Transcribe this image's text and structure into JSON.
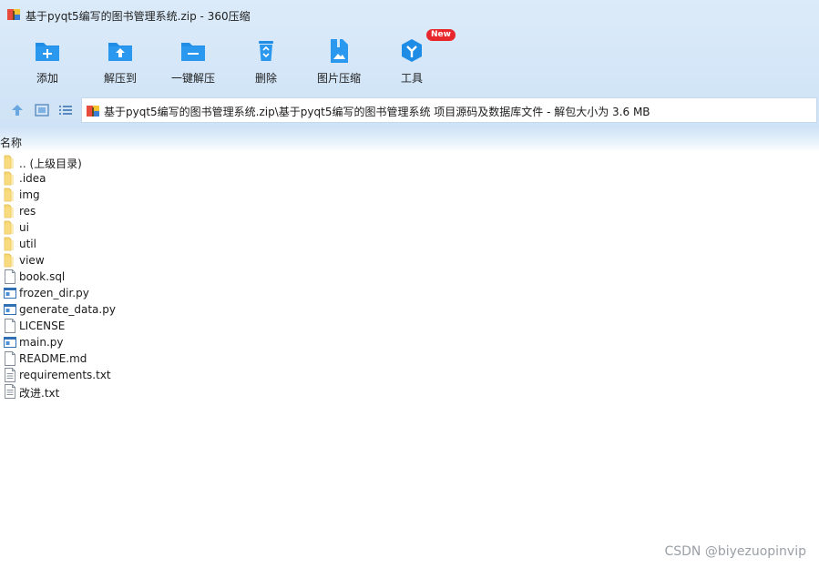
{
  "window": {
    "title": "基于pyqt5编写的图书管理系统.zip - 360压缩"
  },
  "toolbar": [
    {
      "label": "添加",
      "icon": "add-folder-icon"
    },
    {
      "label": "解压到",
      "icon": "extract-to-icon"
    },
    {
      "label": "一键解压",
      "icon": "one-click-extract-icon"
    },
    {
      "label": "删除",
      "icon": "recycle-delete-icon"
    },
    {
      "label": "图片压缩",
      "icon": "image-compress-icon"
    },
    {
      "label": "工具",
      "icon": "tools-icon",
      "badge": "New"
    }
  ],
  "address": {
    "path": "基于pyqt5编写的图书管理系统.zip\\基于pyqt5编写的图书管理系统 项目源码及数据库文件 - 解包大小为 3.6 MB"
  },
  "list": {
    "header": "名称",
    "items": [
      {
        "name": ".. (上级目录)",
        "type": "folder"
      },
      {
        "name": ".idea",
        "type": "folder"
      },
      {
        "name": "img",
        "type": "folder"
      },
      {
        "name": "res",
        "type": "folder"
      },
      {
        "name": "ui",
        "type": "folder"
      },
      {
        "name": "util",
        "type": "folder"
      },
      {
        "name": "view",
        "type": "folder"
      },
      {
        "name": "book.sql",
        "type": "file"
      },
      {
        "name": "frozen_dir.py",
        "type": "py"
      },
      {
        "name": "generate_data.py",
        "type": "py"
      },
      {
        "name": "LICENSE",
        "type": "file"
      },
      {
        "name": "main.py",
        "type": "py"
      },
      {
        "name": "README.md",
        "type": "file"
      },
      {
        "name": "requirements.txt",
        "type": "txt"
      },
      {
        "name": "改进.txt",
        "type": "txt"
      }
    ]
  },
  "watermark": "CSDN @biyezuopinvip",
  "colors": {
    "accent": "#1f8ce6",
    "folder": "#f7d774",
    "badge": "#e8272d"
  }
}
